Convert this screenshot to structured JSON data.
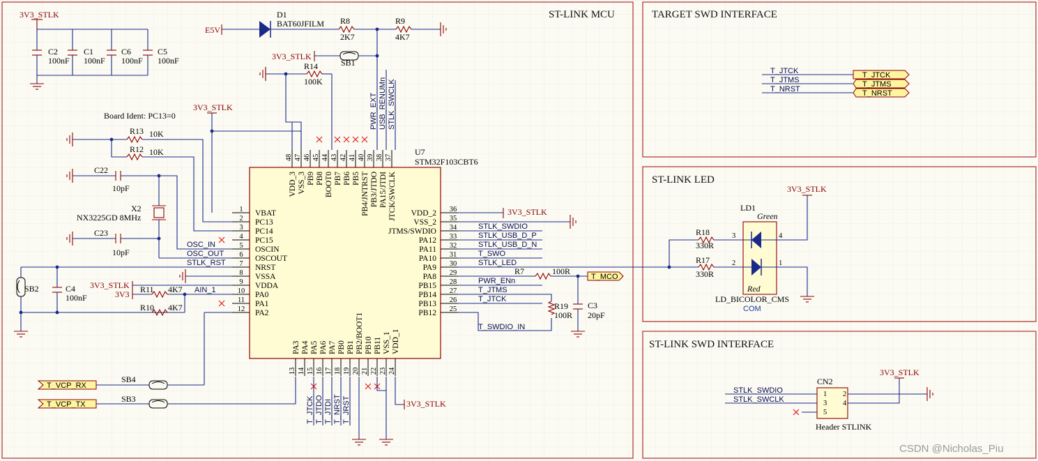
{
  "frames": {
    "mcu": "ST-LINK MCU",
    "target": "TARGET SWD INTERFACE",
    "led": "ST-LINK LED",
    "swd": "ST-LINK SWD INTERFACE"
  },
  "power": {
    "v3": "3V3_STLK",
    "e5v": "E5V",
    "v3short": "3V3"
  },
  "caps": {
    "c2": "C2",
    "c1": "C1",
    "c6": "C6",
    "c5": "C5",
    "val100n": "100nF",
    "c22": "C22",
    "c23": "C23",
    "val10p": "10pF",
    "c4": "C4",
    "c3": "C3",
    "val20p": "20pF"
  },
  "diode": {
    "ref": "D1",
    "part": "BAT60JFILM"
  },
  "resistors": {
    "r8": "R8",
    "r8v": "2K7",
    "r9": "R9",
    "r9v": "4K7",
    "r14": "R14",
    "r14v": "100K",
    "r13": "R13",
    "r13v": "10K",
    "r12": "R12",
    "r12v": "10K",
    "r11": "R11",
    "r11v": "4K7",
    "r10": "R10",
    "r10v": "4K7",
    "r7": "R7",
    "r7v": "100R",
    "r19": "R19",
    "r19v": "100R",
    "r18": "R18",
    "r18v": "330R",
    "r17": "R17",
    "r17v": "330R"
  },
  "solder_bridges": {
    "sb1": "SB1",
    "sb2": "SB2",
    "sb3": "SB3",
    "sb4": "SB4"
  },
  "board_ident": "Board Ident: PC13=0",
  "crystal": {
    "ref": "X2",
    "part": "NX3225GD 8MHz"
  },
  "mcu": {
    "ref": "U7",
    "part": "STM32F103CBT6",
    "left_pins": [
      {
        "num": "1",
        "name": "VBAT"
      },
      {
        "num": "2",
        "name": "PC13"
      },
      {
        "num": "3",
        "name": "PC14"
      },
      {
        "num": "4",
        "name": "PC15"
      },
      {
        "num": "5",
        "name": "OSCIN"
      },
      {
        "num": "6",
        "name": "OSCOUT"
      },
      {
        "num": "7",
        "name": "NRST"
      },
      {
        "num": "8",
        "name": "VSSA"
      },
      {
        "num": "9",
        "name": "VDDA"
      },
      {
        "num": "10",
        "name": "PA0"
      },
      {
        "num": "11",
        "name": "PA1"
      },
      {
        "num": "12",
        "name": "PA2"
      }
    ],
    "right_pins": [
      {
        "num": "36",
        "name": "VDD_2"
      },
      {
        "num": "35",
        "name": "VSS_2"
      },
      {
        "num": "34",
        "name": "JTMS/SWDIO"
      },
      {
        "num": "33",
        "name": "PA12"
      },
      {
        "num": "32",
        "name": "PA11"
      },
      {
        "num": "31",
        "name": "PA10"
      },
      {
        "num": "30",
        "name": "PA9"
      },
      {
        "num": "29",
        "name": "PA8"
      },
      {
        "num": "28",
        "name": "PB15"
      },
      {
        "num": "27",
        "name": "PB14"
      },
      {
        "num": "26",
        "name": "PB13"
      },
      {
        "num": "25",
        "name": "PB12"
      }
    ],
    "top_pins": [
      {
        "num": "48",
        "name": "VDD_3"
      },
      {
        "num": "47",
        "name": "VSS_3"
      },
      {
        "num": "46",
        "name": "PB9"
      },
      {
        "num": "45",
        "name": "PB8"
      },
      {
        "num": "44",
        "name": "BOOT0"
      },
      {
        "num": "43",
        "name": "PB7"
      },
      {
        "num": "42",
        "name": "PB6"
      },
      {
        "num": "41",
        "name": "PB5"
      },
      {
        "num": "40",
        "name": "PB4/JNTRST"
      },
      {
        "num": "39",
        "name": "PB3/JTDO"
      },
      {
        "num": "38",
        "name": "PA15/JTDI"
      },
      {
        "num": "37",
        "name": "JTCK/SWCLK"
      }
    ],
    "bottom_pins": [
      {
        "num": "13",
        "name": "PA3"
      },
      {
        "num": "14",
        "name": "PA4"
      },
      {
        "num": "15",
        "name": "PA5"
      },
      {
        "num": "16",
        "name": "PA6"
      },
      {
        "num": "17",
        "name": "PA7"
      },
      {
        "num": "18",
        "name": "PB0"
      },
      {
        "num": "19",
        "name": "PB1"
      },
      {
        "num": "20",
        "name": "PB2/BOOT1"
      },
      {
        "num": "21",
        "name": "PB10"
      },
      {
        "num": "22",
        "name": "PB11"
      },
      {
        "num": "23",
        "name": "VSS_1"
      },
      {
        "num": "24",
        "name": "VDD_1"
      }
    ]
  },
  "nets": {
    "osc_in": "OSC_IN",
    "osc_out": "OSC_OUT",
    "stlk_rst": "STLK_RST",
    "ain1": "AIN_1",
    "stlk_swdio": "STLK_SWDIO",
    "usb_dp": "STLK_USB_D_P",
    "usb_dn": "STLK_USB_D_N",
    "t_swo": "T_SWO",
    "stlk_led": "STLK_LED",
    "pwr_enn": "PWR_ENn",
    "t_jtms": "T_JTMS",
    "t_jtck": "T_JTCK",
    "t_swdio_in": "T_SWDIO_IN",
    "pwr_ext": "PWR_EXT",
    "usb_renumn": "USB_RENUMn",
    "stlk_swclk": "STLK_SWCLK",
    "t_jtck_v": "T_JTCK",
    "t_jtdo": "T_JTDO",
    "t_jtdi": "T_JTDI",
    "t_nrst": "T_NRST",
    "t_jrst": "T_JRST",
    "t_nrst_h": "T_NRST",
    "t_jtms_h": "T_JTMS",
    "t_jtck_h": "T_JTCK",
    "stlk_swdio2": "STLK_SWDIO",
    "stlk_swclk2": "STLK_SWCLK"
  },
  "ports": {
    "t_mco": "T_MCO",
    "t_vcp_rx": "T_VCP_RX",
    "t_vcp_tx": "T_VCP_TX",
    "t_jtck": "T_JTCK",
    "t_jtms": "T_JTMS",
    "t_nrst": "T_NRST"
  },
  "led": {
    "ref": "LD1",
    "part": "LD_BICOLOR_CMS",
    "com": "COM",
    "green": "Green",
    "red": "Red",
    "p1": "1",
    "p2": "2",
    "p3": "3",
    "p4": "4"
  },
  "header": {
    "ref": "CN2",
    "part": "Header STLINK",
    "pins": [
      "1",
      "2",
      "3",
      "4",
      "5"
    ]
  },
  "watermark": "CSDN @Nicholas_Piu"
}
